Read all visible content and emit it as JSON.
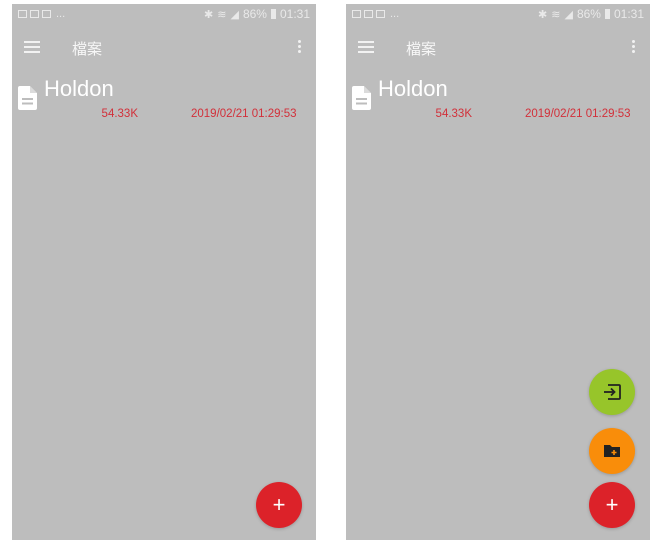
{
  "colors": {
    "screen_bg": "#bdbdbd",
    "text_red": "#d2303a",
    "fab_red": "#dc2229",
    "fab_green": "#97c52a",
    "fab_orange": "#f98d0a"
  },
  "screens": [
    {
      "status_bar": {
        "dots": "...",
        "battery": "86%",
        "time": "01:31",
        "icons": [
          "image-icon",
          "photo-icon",
          "gallery-icon",
          "bluetooth-icon",
          "wifi-icon",
          "signal-icon",
          "battery-icon"
        ]
      },
      "app_bar": {
        "title": "檔案",
        "menu_icon": "menu-icon",
        "more_icon": "more-vert-icon"
      },
      "files": [
        {
          "name": "Holdon",
          "size": "54.33K",
          "date": "2019/02/21 01:29:53",
          "icon": "file-document-icon"
        }
      ],
      "fab": {
        "label": "+",
        "icon": "plus-icon",
        "expanded": false
      }
    },
    {
      "status_bar": {
        "dots": "...",
        "battery": "86%",
        "time": "01:31",
        "icons": [
          "image-icon",
          "photo-icon",
          "gallery-icon",
          "bluetooth-icon",
          "wifi-icon",
          "signal-icon",
          "battery-icon"
        ]
      },
      "app_bar": {
        "title": "檔案",
        "menu_icon": "menu-icon",
        "more_icon": "more-vert-icon"
      },
      "files": [
        {
          "name": "Holdon",
          "size": "54.33K",
          "date": "2019/02/21 01:29:53",
          "icon": "file-document-icon"
        }
      ],
      "fab": {
        "label": "+",
        "icon": "plus-icon",
        "expanded": true
      },
      "fab_menu": [
        {
          "icon": "import-file-icon"
        },
        {
          "icon": "new-folder-icon"
        }
      ]
    }
  ]
}
